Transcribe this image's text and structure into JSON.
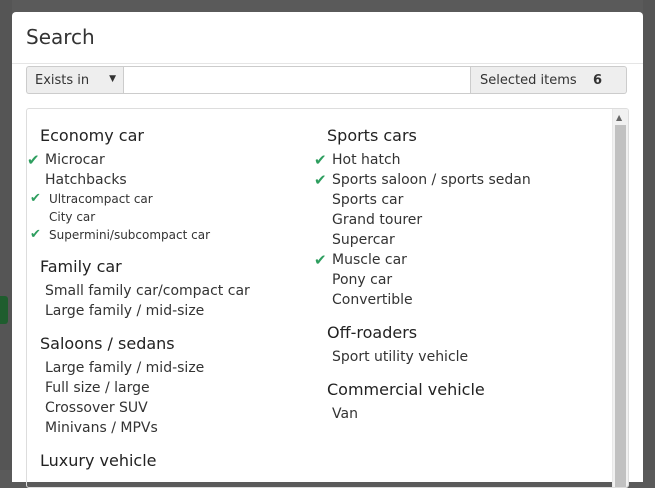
{
  "modal": {
    "title": "Search"
  },
  "search": {
    "scope_selected": "Exists in",
    "query_value": "",
    "query_placeholder": "",
    "selected_label": "Selected items",
    "selected_count": "6"
  },
  "colors": {
    "check": "#2e9e5f",
    "panel_border": "#dddddd"
  },
  "icons": {
    "check": "check-icon",
    "caret": "caret-down-icon",
    "scroll_up": "scroll-up-arrow-icon"
  },
  "columns": [
    {
      "groups": [
        {
          "title": "Economy car",
          "items": [
            {
              "label": "Microcar",
              "checked": true,
              "small": false
            },
            {
              "label": "Hatchbacks",
              "checked": false,
              "small": false
            },
            {
              "label": "Ultracompact car",
              "checked": true,
              "small": true
            },
            {
              "label": "City car",
              "checked": false,
              "small": true
            },
            {
              "label": "Supermini/subcompact car",
              "checked": true,
              "small": true
            }
          ]
        },
        {
          "title": "Family car",
          "items": [
            {
              "label": "Small family car/compact car",
              "checked": false,
              "small": false
            },
            {
              "label": "Large family / mid-size",
              "checked": false,
              "small": false
            }
          ]
        },
        {
          "title": "Saloons / sedans",
          "items": [
            {
              "label": "Large family / mid-size",
              "checked": false,
              "small": false
            },
            {
              "label": "Full size / large",
              "checked": false,
              "small": false
            },
            {
              "label": "Crossover SUV",
              "checked": false,
              "small": false
            },
            {
              "label": "Minivans / MPVs",
              "checked": false,
              "small": false
            }
          ]
        },
        {
          "title": "Luxury vehicle",
          "items": []
        }
      ]
    },
    {
      "groups": [
        {
          "title": "Sports cars",
          "items": [
            {
              "label": "Hot hatch",
              "checked": true,
              "small": false
            },
            {
              "label": "Sports saloon / sports sedan",
              "checked": true,
              "small": false
            },
            {
              "label": "Sports car",
              "checked": false,
              "small": false
            },
            {
              "label": "Grand tourer",
              "checked": false,
              "small": false
            },
            {
              "label": "Supercar",
              "checked": false,
              "small": false
            },
            {
              "label": "Muscle car",
              "checked": true,
              "small": false
            },
            {
              "label": "Pony car",
              "checked": false,
              "small": false
            },
            {
              "label": "Convertible",
              "checked": false,
              "small": false
            }
          ]
        },
        {
          "title": "Off-roaders",
          "items": [
            {
              "label": "Sport utility vehicle",
              "checked": false,
              "small": false
            }
          ]
        },
        {
          "title": "Commercial vehicle",
          "items": [
            {
              "label": "Van",
              "checked": false,
              "small": false
            }
          ]
        }
      ]
    }
  ]
}
